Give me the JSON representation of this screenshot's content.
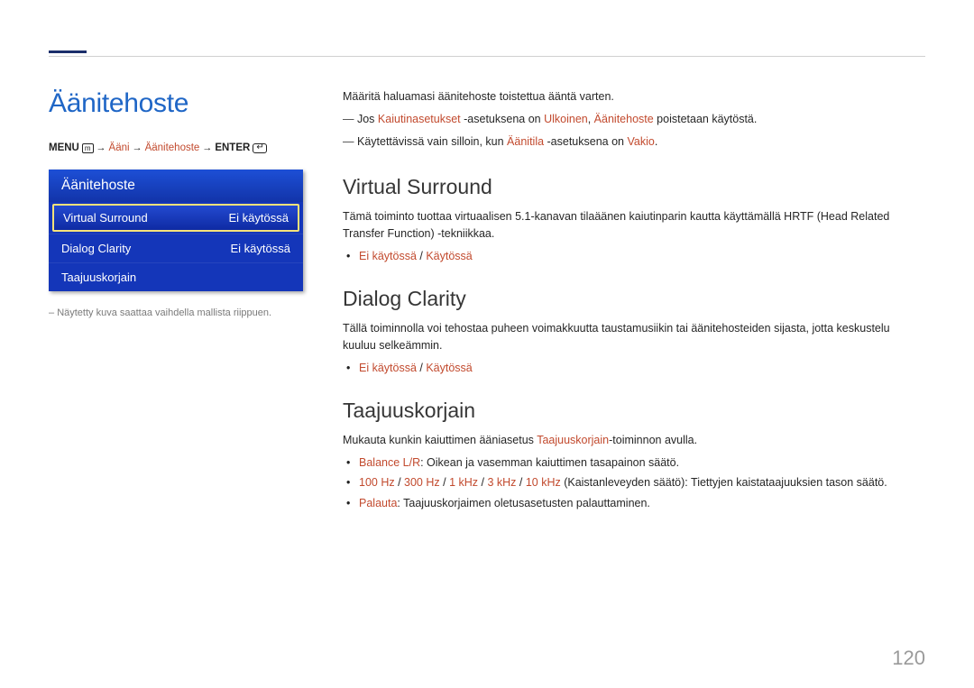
{
  "pageNumber": "120",
  "left": {
    "title": "Äänitehoste",
    "breadcrumb": {
      "menu": "MENU",
      "p1": "Ääni",
      "p2": "Äänitehoste",
      "enter": "ENTER"
    },
    "menu": {
      "header": "Äänitehoste",
      "rows": [
        {
          "label": "Virtual Surround",
          "value": "Ei käytössä",
          "selected": true
        },
        {
          "label": "Dialog Clarity",
          "value": "Ei käytössä",
          "selected": false
        },
        {
          "label": "Taajuuskorjain",
          "value": "",
          "selected": false
        }
      ]
    },
    "footnote": "Näytetty kuva saattaa vaihdella mallista riippuen."
  },
  "right": {
    "intro": "Määritä haluamasi äänitehoste toistettua ääntä varten.",
    "note1_a": "Jos ",
    "note1_b": "Kaiutinasetukset",
    "note1_c": " -asetuksena on ",
    "note1_d": "Ulkoinen",
    "note1_e": ", ",
    "note1_f": "Äänitehoste",
    "note1_g": " poistetaan käytöstä.",
    "note2_a": "Käytettävissä vain silloin, kun ",
    "note2_b": "Äänitila",
    "note2_c": " -asetuksena on ",
    "note2_d": "Vakio",
    "note2_e": ".",
    "sec1": {
      "title": "Virtual Surround",
      "desc": "Tämä toiminto tuottaa virtuaalisen 5.1-kanavan tilaäänen kaiutinparin kautta käyttämällä HRTF (Head Related Transfer Function) -tekniikkaa.",
      "opt_off": "Ei käytössä",
      "opt_sep": " / ",
      "opt_on": "Käytössä"
    },
    "sec2": {
      "title": "Dialog Clarity",
      "desc": "Tällä toiminnolla voi tehostaa puheen voimakkuutta taustamusiikin tai äänitehosteiden sijasta, jotta keskustelu kuuluu selkeämmin.",
      "opt_off": "Ei käytössä",
      "opt_sep": " / ",
      "opt_on": "Käytössä"
    },
    "sec3": {
      "title": "Taajuuskorjain",
      "desc_a": "Mukauta kunkin kaiuttimen ääniasetus ",
      "desc_b": "Taajuuskorjain",
      "desc_c": "-toiminnon avulla.",
      "b1_label": "Balance L/R",
      "b1_text": ": Oikean ja vasemman kaiuttimen tasapainon säätö.",
      "b2_f1": "100 Hz",
      "b2_f2": "300 Hz",
      "b2_f3": "1 kHz",
      "b2_f4": "3 kHz",
      "b2_f5": "10 kHz",
      "b2_sep": " / ",
      "b2_text": " (Kaistanleveyden säätö): Tiettyjen kaistataajuuksien tason säätö.",
      "b3_label": "Palauta",
      "b3_text": ": Taajuuskorjaimen oletusasetusten palauttaminen."
    }
  }
}
